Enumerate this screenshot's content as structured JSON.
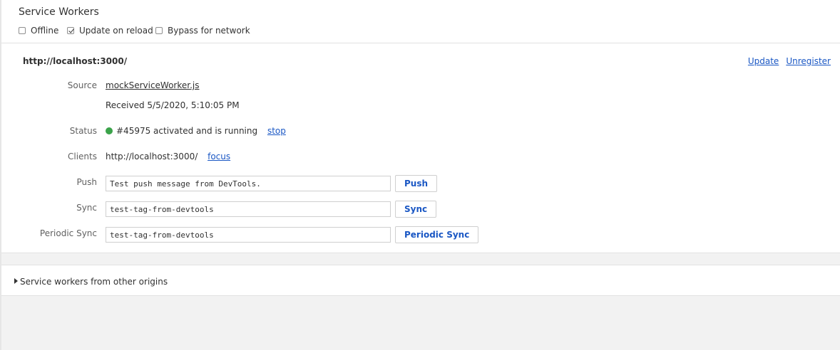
{
  "panel": {
    "title": "Service Workers"
  },
  "options": [
    {
      "label": "Offline",
      "checked": false
    },
    {
      "label": "Update on reload",
      "checked": true
    },
    {
      "label": "Bypass for network",
      "checked": false
    }
  ],
  "worker": {
    "origin": "http://localhost:3000/",
    "update_label": "Update",
    "unregister_label": "Unregister",
    "source_label": "Source",
    "source_file": "mockServiceWorker.js",
    "received": "Received 5/5/2020, 5:10:05 PM",
    "status_label": "Status",
    "status_text": "#45975 activated and is running",
    "status_color": "#3ba34a",
    "stop_label": "stop",
    "clients_label": "Clients",
    "client_url": "http://localhost:3000/",
    "focus_label": "focus",
    "push_label": "Push",
    "push_value": "Test push message from DevTools.",
    "push_button": "Push",
    "sync_label": "Sync",
    "sync_value": "test-tag-from-devtools",
    "sync_button": "Sync",
    "periodic_label": "Periodic Sync",
    "periodic_value": "test-tag-from-devtools",
    "periodic_button": "Periodic Sync"
  },
  "other_origins": {
    "label": "Service workers from other origins"
  },
  "colors": {
    "link": "#1a57c4",
    "accent_status": "#3ba34a"
  }
}
